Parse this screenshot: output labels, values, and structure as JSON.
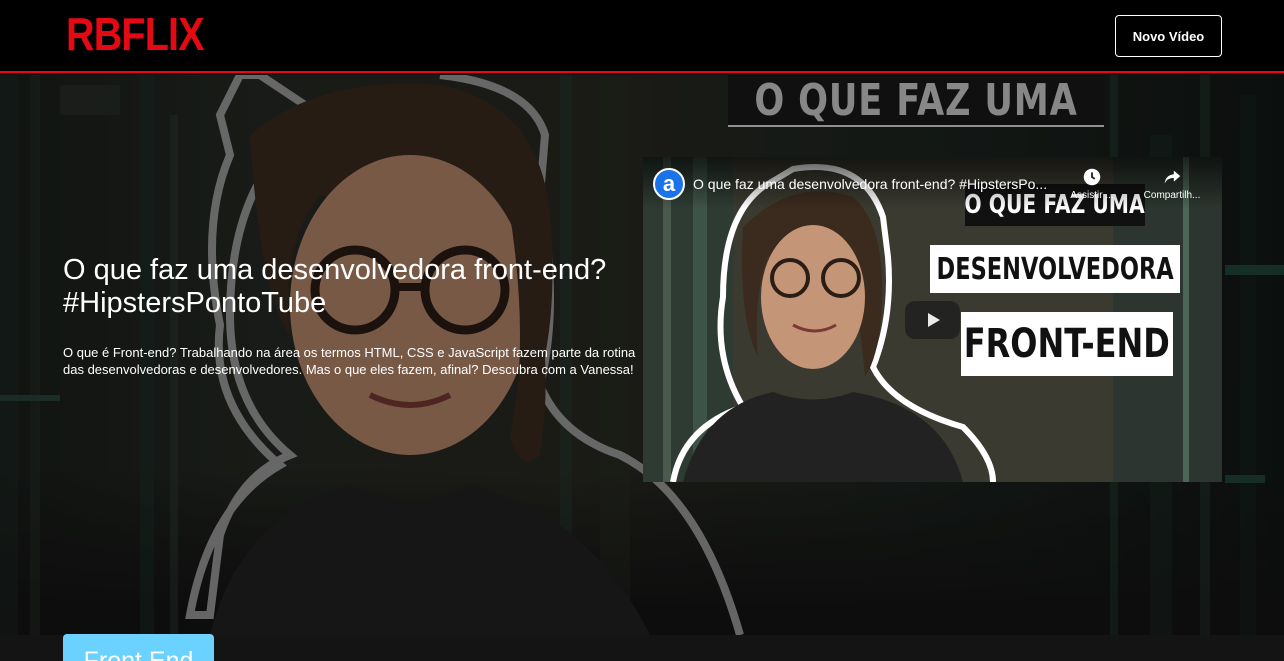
{
  "header": {
    "logo": "RBFLIX",
    "new_video_label": "Novo Vídeo"
  },
  "banner": {
    "background_caption": "O QUE FAZ UMA",
    "title": "O que faz uma desenvolvedora front-end? #HipstersPontoTube",
    "description": "O que é Front-end? Trabalhando na área os termos HTML, CSS e JavaScript fazem parte da rotina das desenvolvedoras e desenvolvedores. Mas o que eles fazem, afinal? Descubra com a Vanessa!"
  },
  "player": {
    "channel_initial": "a",
    "title": "O que faz uma desenvolvedora front-end? #HipstersPo...",
    "watch_later_label": "Assistir ...",
    "share_label": "Compartilh...",
    "captions": [
      "O QUE FAZ UMA",
      "DESENVOLVEDORA",
      "FRONT-END"
    ]
  },
  "category": {
    "label": "Front End",
    "color": "#6bd1ff"
  },
  "colors": {
    "brand": "#e50914",
    "background": "#141414"
  }
}
